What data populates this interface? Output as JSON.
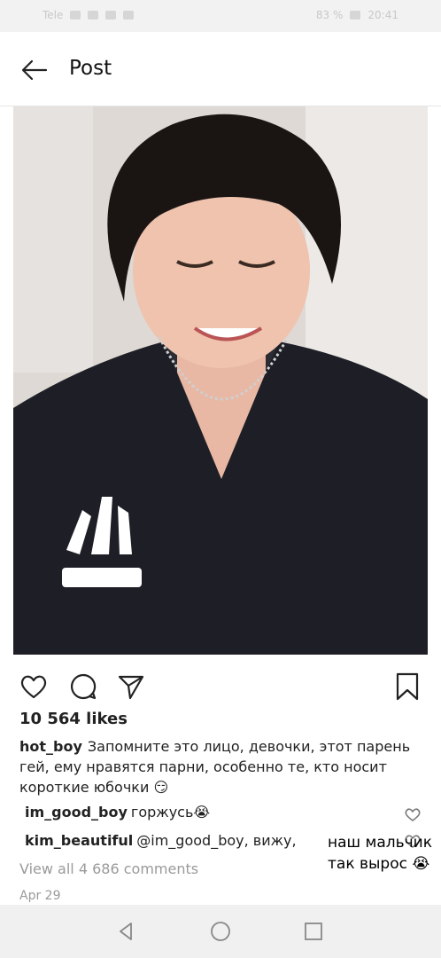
{
  "status_bar": {
    "left_text": "Tele",
    "battery": "83 %",
    "time": "20:41"
  },
  "header": {
    "back_icon": "arrow-left-icon",
    "title": "Post"
  },
  "post": {
    "image_alt": "photo",
    "likes": "10 564 likes",
    "caption_user": "hot_boy",
    "caption_text": "Запомните это лицо, девочки, этот парень гей, ему нравятся парни, особенно те, кто носит короткие юбочки 😏",
    "comments": [
      {
        "user": "im_good_boy",
        "text": "горжусь😭"
      },
      {
        "user": "kim_beautiful",
        "text": "@im_good_boy, вижу,"
      }
    ],
    "view_all": "View all 4 686 comments",
    "date": "Apr 29",
    "overlay_note": "наш мальчик так вырос 😭"
  },
  "icons": {
    "like": "heart-icon",
    "comment": "comment-icon",
    "share": "send-icon",
    "save": "bookmark-icon"
  },
  "nav_bar": {
    "back": "nav-back-icon",
    "home": "nav-home-icon",
    "recents": "nav-recents-icon"
  },
  "colors": {
    "status_bg": "#f2f2f2",
    "text": "#222222",
    "muted": "#9a9a9a",
    "nav_bg": "#f0f0f0"
  }
}
